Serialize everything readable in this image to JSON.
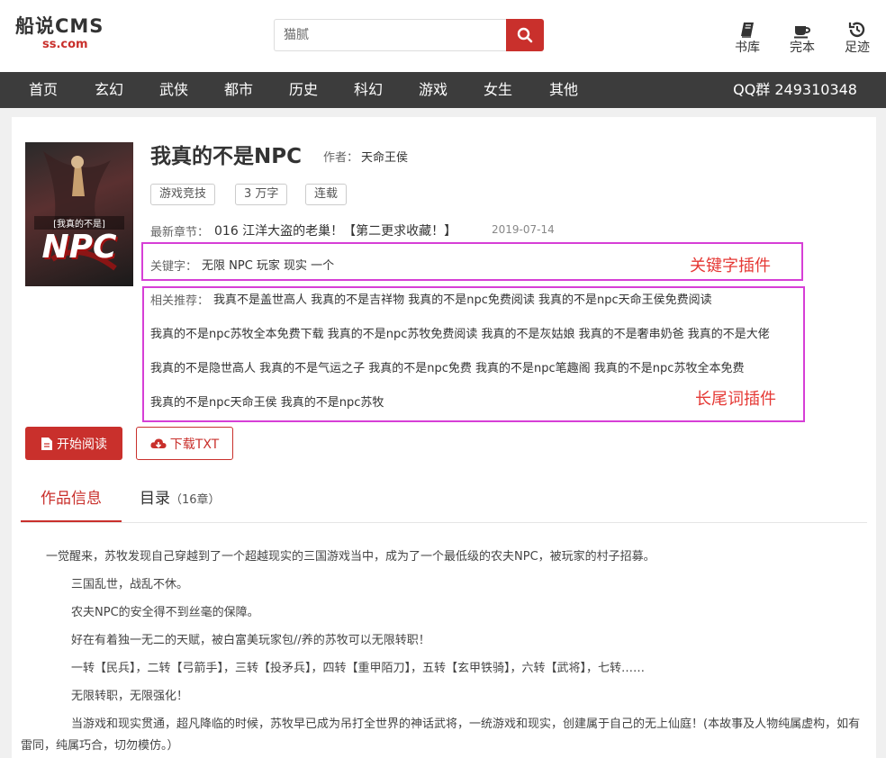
{
  "header": {
    "logo_main": "船说CMS",
    "logo_sub": "ss.com",
    "search_placeholder": "猫腻",
    "links": [
      {
        "label": "书库",
        "icon": "book-icon"
      },
      {
        "label": "完本",
        "icon": "coffee-cup-icon"
      },
      {
        "label": "足迹",
        "icon": "history-icon"
      }
    ]
  },
  "nav": {
    "items": [
      "首页",
      "玄幻",
      "武侠",
      "都市",
      "历史",
      "科幻",
      "游戏",
      "女生",
      "其他"
    ],
    "qq": "QQ群 249310348"
  },
  "book": {
    "cover_small": "[我真的不是]",
    "cover_big": "NPC",
    "title": "我真的不是NPC",
    "author_label": "作者：",
    "author": "天命王侯",
    "tags": [
      "游戏竞技",
      "3 万字",
      "连载"
    ],
    "latest_label": "最新章节：",
    "latest_chapter": "016 江洋大盗的老巢！【第二更求收藏！】",
    "latest_date": "2019-07-14",
    "keywords_label": "关键字：",
    "keywords": "无限 NPC 玩家 现实 一个",
    "related_label": "相关推荐：",
    "related_lines": [
      "我真不是盖世高人 我真的不是吉祥物 我真的不是npc免费阅读 我真的不是npc天命王侯免费阅读",
      "我真的不是npc苏牧全本免费下载 我真的不是npc苏牧免费阅读 我真的不是灰姑娘 我真的不是奢串奶爸 我真的不是大佬",
      "我真的不是隐世高人 我真的不是气运之子 我真的不是npc免费 我真的不是npc笔趣阁 我真的不是npc苏牧全本免费",
      "我真的不是npc天命王侯 我真的不是npc苏牧"
    ]
  },
  "annotations": {
    "keyword_plugin": "关键字插件",
    "longtail_plugin": "长尾词插件"
  },
  "buttons": {
    "read": "开始阅读",
    "download": "下载TXT"
  },
  "tabs": {
    "info": "作品信息",
    "toc": "目录",
    "toc_count": "（16章）"
  },
  "description": [
    "一觉醒来，苏牧发现自己穿越到了一个超越现实的三国游戏当中，成为了一个最低级的农夫NPC，被玩家的村子招募。",
    "三国乱世，战乱不休。",
    "农夫NPC的安全得不到丝毫的保障。",
    "好在有着独一无二的天赋，被白富美玩家包//养的苏牧可以无限转职！",
    "一转【民兵】，二转【弓箭手】，三转【投矛兵】，四转【重甲陌刀】，五转【玄甲铁骑】，六转【武将】，七转……",
    "无限转职，无限强化！",
    "当游戏和现实贯通，超凡降临的时候，苏牧早已成为吊打全世界的神话武将，一统游戏和现实，创建属于自己的无上仙庭！(本故事及人物纯属虚构，如有雷同，纯属巧合，切勿模仿。）"
  ],
  "colors": {
    "accent": "#c9302c",
    "nav_bg": "#3c3c3c",
    "annotation_box": "#d63fd6",
    "annotation_text": "#e53935"
  }
}
